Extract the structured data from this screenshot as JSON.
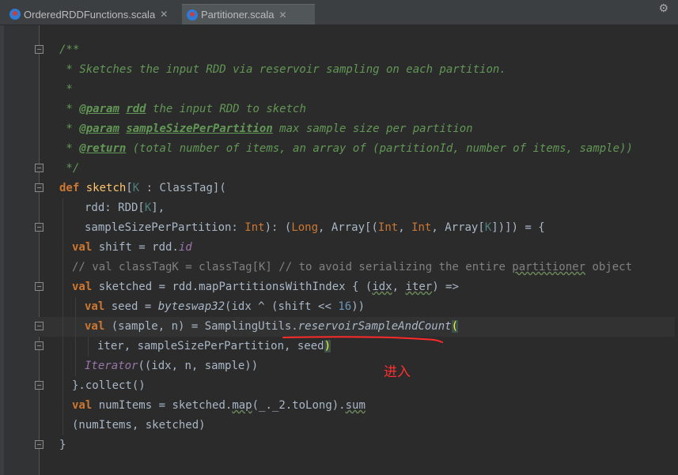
{
  "tabs": [
    {
      "label": "OrderedRDDFunctions.scala",
      "active": false
    },
    {
      "label": "Partitioner.scala",
      "active": true
    }
  ],
  "code": {
    "l1": "/**",
    "l2": " * Sketches the input RDD via reservoir sampling on each partition.",
    "l3": " *",
    "l4_pre": " * ",
    "l4_tag": "@param",
    "l4_sp": " ",
    "l4_name": "rdd",
    "l4_rest": " the input RDD to sketch",
    "l5_pre": " * ",
    "l5_tag": "@param",
    "l5_sp": " ",
    "l5_name": "sampleSizePerPartition",
    "l5_rest": " max sample size per partition",
    "l6_pre": " * ",
    "l6_tag": "@return",
    "l6_rest": " (total number of items, an array of (partitionId, number of items, sample))",
    "l7": " */",
    "l8_kw": "def",
    "l8_sp": " ",
    "l8_fn": "sketch",
    "l8_a": "[",
    "l8_ty": "K",
    "l8_b": " : ClassTag](",
    "l9_a": "rdd: RDD[",
    "l9_ty": "K",
    "l9_b": "],",
    "l10_a": "sampleSizePerPartition: ",
    "l10_ty1": "Int",
    "l10_b": "): (",
    "l10_ty2": "Long",
    "l10_c": ", ",
    "l10_ty3": "Array",
    "l10_d": "[(",
    "l10_ty4": "Int",
    "l10_e": ", ",
    "l10_ty5": "Int",
    "l10_f": ", ",
    "l10_ty6": "Array",
    "l10_g": "[",
    "l10_ty7": "K",
    "l10_h": "])]) = {",
    "l11_kw": "val",
    "l11_a": " shift = rdd.",
    "l11_id": "id",
    "l12_a": "// val classTagK = classTag[K] // to avoid serializing the entire ",
    "l12_typo": "partitioner",
    "l12_b": " object",
    "l13_kw": "val",
    "l13_a": " sketched = rdd.mapPartitionsWithIndex { (",
    "l13_b": "idx",
    "l13_c": ", ",
    "l13_d": "iter",
    "l13_e": ") =>",
    "l14_kw": "val",
    "l14_a": " seed = ",
    "l14_it": "byteswap32",
    "l14_b": "(idx ^ (shift << ",
    "l14_num": "16",
    "l14_c": "))",
    "l15_kw": "val",
    "l15_a": " (sample, n) = SamplingUtils.",
    "l15_it": "reservoirSampleAndCount",
    "l15_bm": "(",
    "l16_a": "iter, sampleSizePerPartition, seed",
    "l16_bm": ")",
    "l17_it": "Iterator",
    "l17_a": "((idx, n, sample))",
    "l18": "}.collect()",
    "l19_kw": "val",
    "l19_a": " numItems = sketched.",
    "l19_u1": "map",
    "l19_b": "(_._2.toLong).",
    "l19_u2": "sum",
    "l20": "(numItems, sketched)",
    "l21": "}"
  },
  "annotation": "进入",
  "icons": {
    "tab_file": "scala-file-icon",
    "close": "close-icon",
    "settings": "settings-icon",
    "fold": "fold-marker-icon"
  },
  "colors": {
    "background": "#2b2b2b",
    "comment": "#629755",
    "keyword": "#cc7832",
    "function": "#ffc66d",
    "annotation": "#ff3030"
  }
}
